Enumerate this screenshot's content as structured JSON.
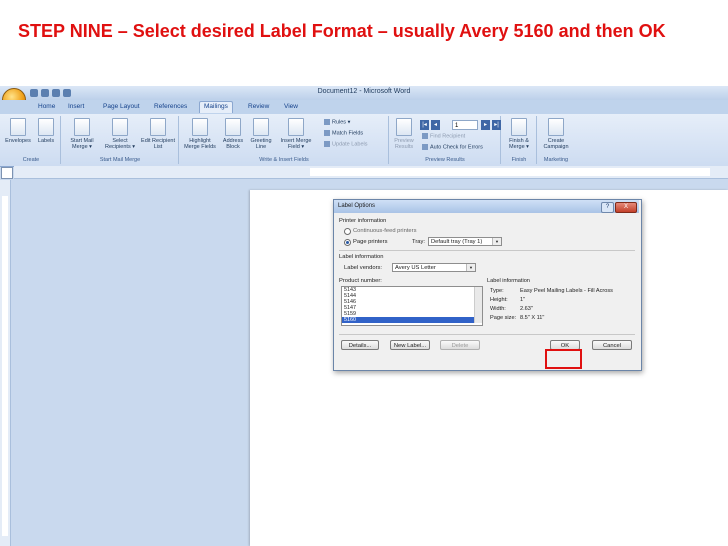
{
  "slide": {
    "title": "STEP NINE – Select desired Label Format – usually Avery 5160 and then OK"
  },
  "window": {
    "title": "Document12 - Microsoft Word"
  },
  "tabs": [
    "Home",
    "Insert",
    "Page Layout",
    "References",
    "Mailings",
    "Review",
    "View"
  ],
  "ribbon": {
    "create": {
      "envelopes": "Envelopes",
      "labels": "Labels",
      "group": "Create"
    },
    "start": {
      "start_mail_merge": "Start Mail Merge ▾",
      "select_recipients": "Select Recipients ▾",
      "edit_recipient_list": "Edit Recipient List",
      "group": "Start Mail Merge"
    },
    "write": {
      "highlight": "Highlight Merge Fields",
      "address_block": "Address Block",
      "greeting_line": "Greeting Line",
      "insert_merge_field": "Insert Merge Field ▾",
      "rules": "Rules ▾",
      "match_fields": "Match Fields",
      "update_labels": "Update Labels",
      "group": "Write & Insert Fields"
    },
    "preview": {
      "preview_results": "Preview Results",
      "record": "1",
      "find_recipient": "Find Recipient",
      "auto_check": "Auto Check for Errors",
      "group": "Preview Results"
    },
    "finish": {
      "finish_merge": "Finish & Merge ▾",
      "group": "Finish"
    },
    "marketing": {
      "create_campaign": "Create Campaign",
      "group": "Marketing"
    }
  },
  "dialog": {
    "title": "Label Options",
    "printer_info_label": "Printer information",
    "continuous": "Continuous-feed printers",
    "page_printers": "Page printers",
    "tray_label": "Tray:",
    "tray_value": "Default tray (Tray 1)",
    "label_info_label": "Label information",
    "label_vendors_label": "Label vendors:",
    "label_vendors_value": "Avery US Letter",
    "product_number_label": "Product number:",
    "products": [
      "5143",
      "5144",
      "5146",
      "5147",
      "5159",
      "5160"
    ],
    "selected_product": "5160",
    "info_heading": "Label information",
    "type_label": "Type:",
    "type_value": "Easy Peel Mailing Labels - Fill Across",
    "height_label": "Height:",
    "height_value": "1\"",
    "width_label": "Width:",
    "width_value": "2.63\"",
    "page_size_label": "Page size:",
    "page_size_value": "8.5\" X 11\"",
    "details_btn": "Details...",
    "new_label_btn": "New Label...",
    "delete_btn": "Delete",
    "ok_btn": "OK",
    "cancel_btn": "Cancel",
    "help_icon": "?",
    "close_icon": "X"
  },
  "colors": {
    "title_red": "#e01010",
    "ribbon_blue": "#cddcf1",
    "selection": "#3162c8"
  }
}
